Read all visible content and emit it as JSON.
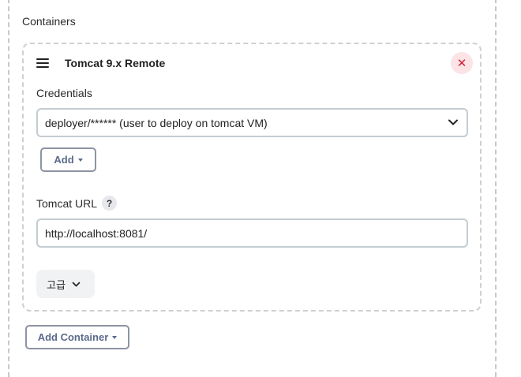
{
  "section": {
    "title": "Containers"
  },
  "container": {
    "title": "Tomcat 9.x Remote",
    "close_symbol": "✕",
    "credentials_label": "Credentials",
    "credentials_value": "deployer/****** (user to deploy on tomcat VM)",
    "add_label": "Add",
    "tomcat_url_label": "Tomcat URL",
    "help_symbol": "?",
    "tomcat_url_value": "http://localhost:8081/",
    "advanced_label": "고급"
  },
  "footer": {
    "add_container_label": "Add Container"
  },
  "icons": {
    "drag": "drag-handle-icon",
    "close": "close-icon",
    "chevron": "chevron-down-icon",
    "caret": "caret-down-icon",
    "help": "help-icon"
  },
  "colors": {
    "close_bg": "#fbe3e6",
    "close_fg": "#d1213b",
    "button_text": "#5b6a8a",
    "input_border": "#c3ccd1"
  }
}
